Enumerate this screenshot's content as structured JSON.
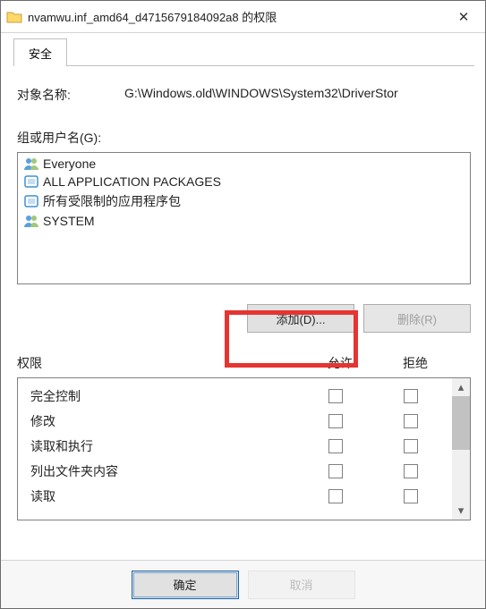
{
  "window": {
    "title": "nvamwu.inf_amd64_d4715679184092a8 的权限",
    "close_glyph": "✕"
  },
  "tab": {
    "security": "安全"
  },
  "object": {
    "label": "对象名称:",
    "value": "G:\\Windows.old\\WINDOWS\\System32\\DriverStor"
  },
  "groups": {
    "label": "组或用户名(G):",
    "items": [
      {
        "icon": "users",
        "name": "Everyone"
      },
      {
        "icon": "package",
        "name": "ALL APPLICATION PACKAGES"
      },
      {
        "icon": "package",
        "name": "所有受限制的应用程序包"
      },
      {
        "icon": "users",
        "name": "SYSTEM"
      }
    ]
  },
  "buttons": {
    "add": "添加(D)...",
    "remove": "删除(R)",
    "ok": "确定",
    "cancel": "取消"
  },
  "perm": {
    "header_name": "权限",
    "header_allow": "允许",
    "header_deny": "拒绝",
    "rows": [
      "完全控制",
      "修改",
      "读取和执行",
      "列出文件夹内容",
      "读取"
    ]
  }
}
